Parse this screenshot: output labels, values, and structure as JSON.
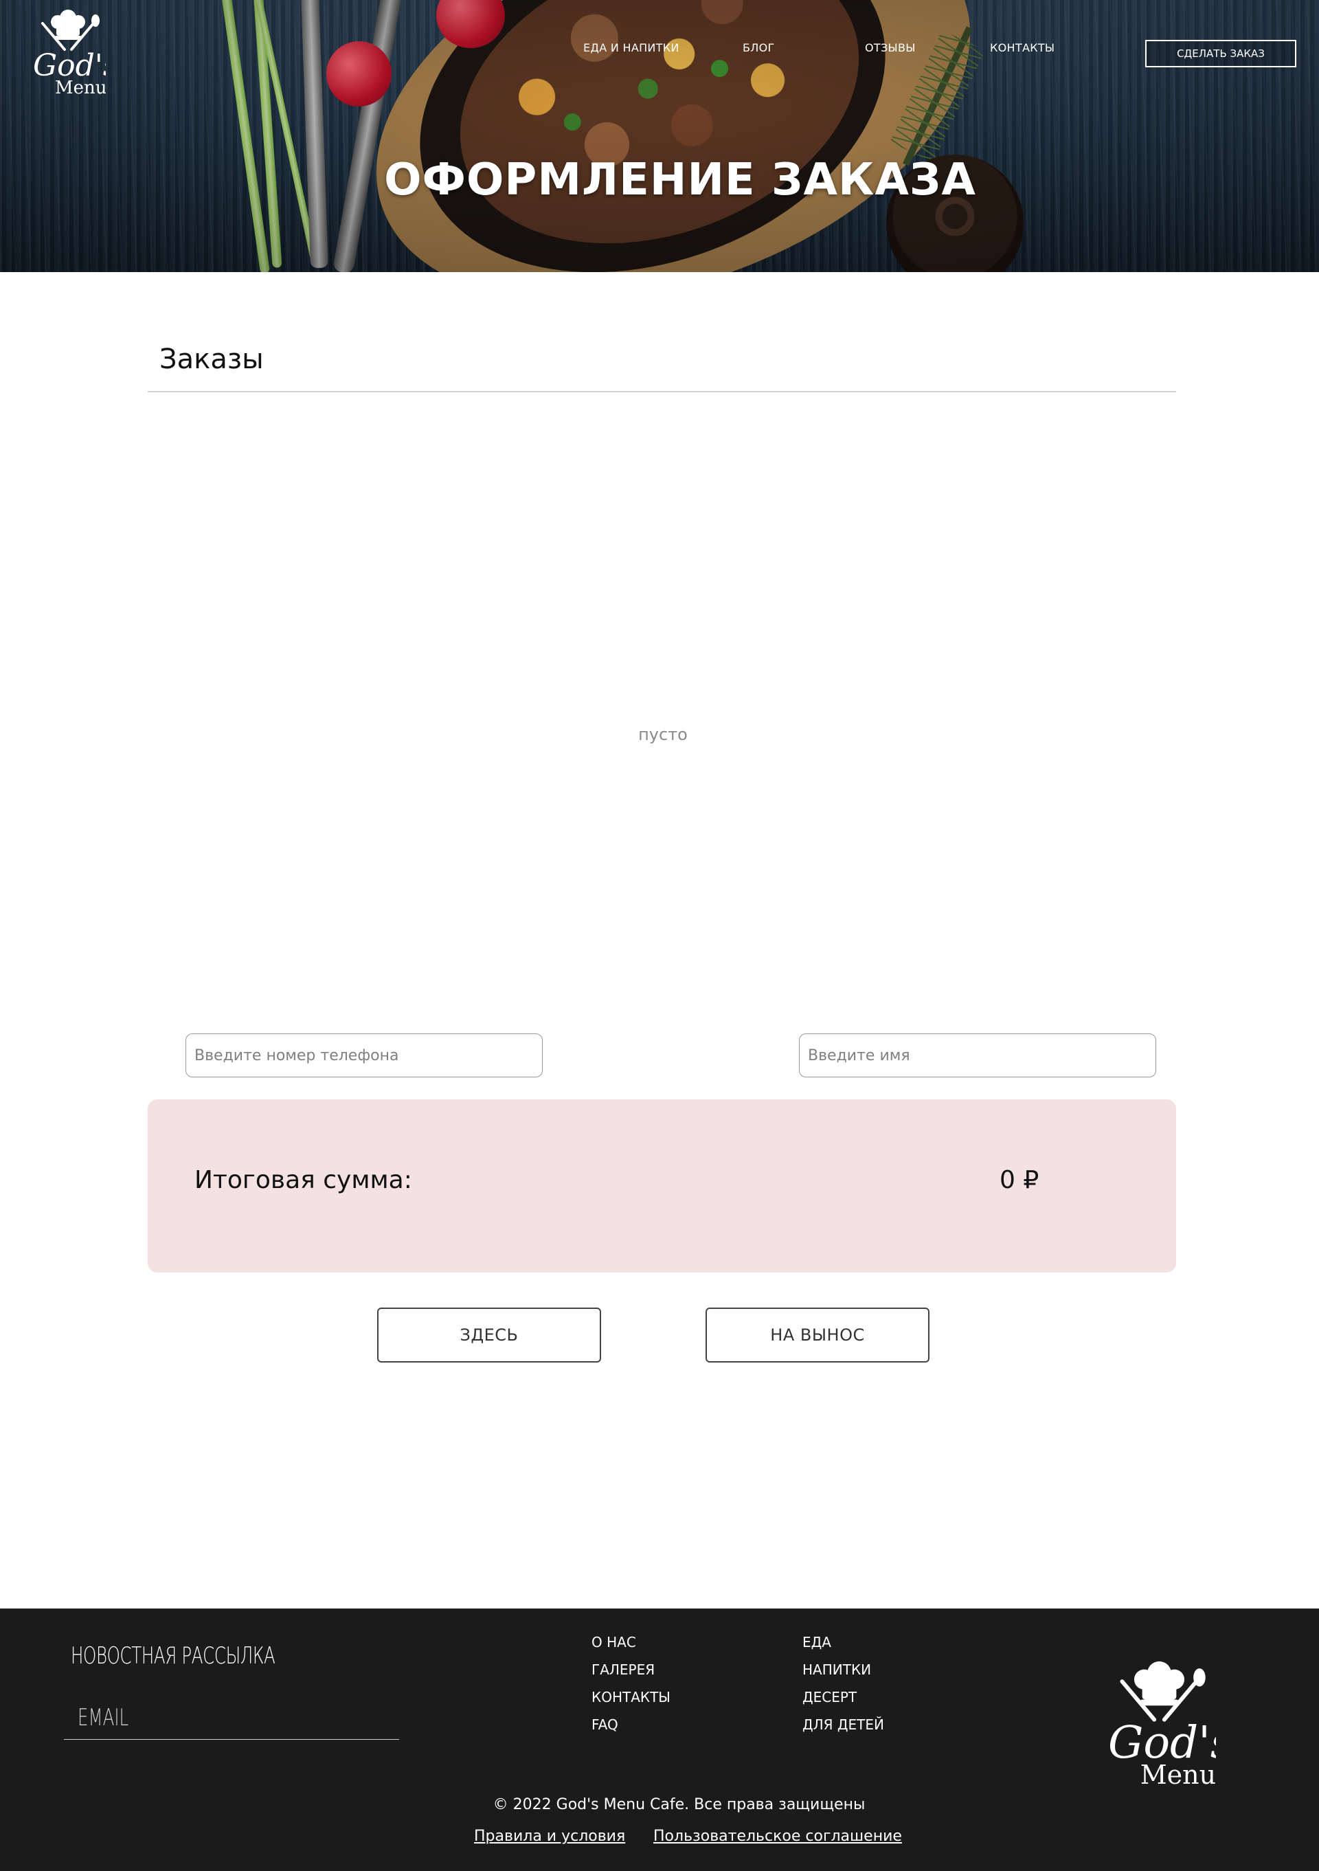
{
  "brand": {
    "logo_line1": "God's",
    "logo_line2": "Menu"
  },
  "nav": {
    "items": [
      {
        "label": "ЕДА И НАПИТКИ"
      },
      {
        "label": "БЛОГ"
      },
      {
        "label": "ОТЗЫВЫ"
      },
      {
        "label": "КОНТАКТЫ"
      }
    ],
    "cta_label": "СДЕЛАТЬ ЗАКАЗ"
  },
  "hero": {
    "title": "ОФОРМЛЕНИЕ ЗАКАЗА"
  },
  "orders": {
    "title": "Заказы",
    "empty_text": "пусто"
  },
  "form": {
    "phone_placeholder": "Введите номер телефона",
    "phone_value": "",
    "name_placeholder": "Введите имя",
    "name_value": ""
  },
  "summary": {
    "label": "Итоговая сумма:",
    "value": "0 ₽"
  },
  "actions": {
    "here_label": "ЗДЕСЬ",
    "takeaway_label": "НА ВЫНОС"
  },
  "footer": {
    "newsletter_title": "НОВОСТНАЯ РАССЫЛКА",
    "email_placeholder": "EMAIL",
    "col1": [
      "О НАС",
      "ГАЛЕРЕЯ",
      "КОНТАКТЫ",
      "FAQ"
    ],
    "col2": [
      "ЕДА",
      "НАПИТКИ",
      "ДЕСЕРТ",
      "ДЛЯ ДЕТЕЙ"
    ],
    "copyright": "© 2022 God's Menu Cafe. Все права защищены",
    "terms_label": "Правила и условия",
    "agreement_label": "Пользовательское соглашение"
  },
  "colors": {
    "summary_bg": "#f4e2e2",
    "footer_bg": "#1b1b1b",
    "hero_bg": "#1d2f41"
  }
}
